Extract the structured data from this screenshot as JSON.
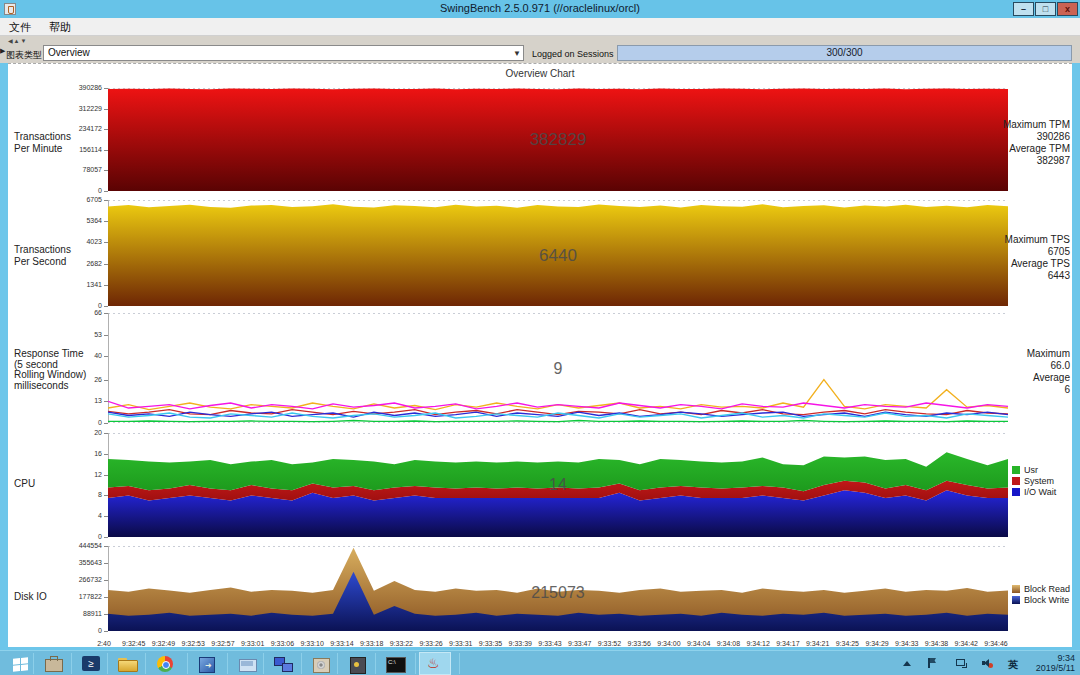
{
  "window": {
    "title": "SwingBench 2.5.0.971  (//oraclelinux/orcl)",
    "minimize": "–",
    "maximize": "□",
    "close": "x"
  },
  "menu": {
    "items": [
      "文件",
      "帮助"
    ]
  },
  "toolbar": {
    "chart_type_label": "图表类型",
    "chart_type_value": "Overview",
    "sessions_label": "Logged on Sessions",
    "sessions_value": "300/300"
  },
  "panel_title": "Overview Chart",
  "chart_data": {
    "type": "area",
    "x_labels": [
      "2:40",
      "9:32:45",
      "9:32:49",
      "9:32:53",
      "9:32:57",
      "9:33:01",
      "9:33:06",
      "9:33:10",
      "9:33:14",
      "9:33:18",
      "9:33:22",
      "9:33:26",
      "9:33:31",
      "9:33:35",
      "9:33:39",
      "9:33:43",
      "9:33:47",
      "9:33:52",
      "9:33:56",
      "9:34:00",
      "9:34:04",
      "9:34:08",
      "9:34:12",
      "9:34:17",
      "9:34:21",
      "9:34:25",
      "9:34:29",
      "9:34:33",
      "9:34:38",
      "9:34:42",
      "9:34:46"
    ],
    "charts": [
      {
        "id": "tpm",
        "type": "area",
        "title_lines": [
          "Transactions",
          "Per Minute"
        ],
        "ymax": 390286,
        "yticks": [
          390286,
          312229,
          234172,
          156114,
          78057,
          0
        ],
        "value_label": "382829",
        "stats_lines": [
          "Maximum TPM",
          "390286",
          "Average TPM",
          "382987"
        ],
        "series": [
          {
            "name": "TPM",
            "color_top": "#ee1313",
            "color_bottom": "#5a0303",
            "values": [
              386500,
              387800,
              386200,
              388400,
              387000,
              385600,
              388200,
              387400,
              386000,
              388600,
              387200,
              385800,
              387600,
              388800,
              386400,
              387000,
              388200,
              385600,
              387800,
              386600,
              388400,
              387000,
              385800,
              388000,
              386800,
              387600,
              385400,
              388200,
              387000,
              386200,
              388600,
              387400,
              385800,
              387200,
              388400,
              386000,
              387800,
              386600,
              388200,
              385600,
              387400,
              388000,
              386400,
              387800,
              386800
            ]
          }
        ]
      },
      {
        "id": "tps",
        "type": "area",
        "title_lines": [
          "Transactions",
          "Per Second"
        ],
        "ymax": 6705,
        "yticks": [
          6705,
          5364,
          4023,
          2682,
          1341,
          0
        ],
        "value_label": "6440",
        "stats_lines": [
          "Maximum TPS",
          "6705",
          "Average TPS",
          "6443"
        ],
        "series": [
          {
            "name": "TPS",
            "color_top": "#ecca10",
            "color_bottom": "#6e2604",
            "values": [
              6290,
              6380,
              6250,
              6330,
              6410,
              6270,
              6220,
              6350,
              6390,
              6260,
              6310,
              6430,
              6280,
              6230,
              6370,
              6320,
              6250,
              6400,
              6290,
              6340,
              6220,
              6380,
              6300,
              6260,
              6420,
              6330,
              6270,
              6350,
              6240,
              6390,
              6310,
              6280,
              6430,
              6250,
              6320,
              6370,
              6230,
              6360,
              6300,
              6410,
              6270,
              6340,
              6250,
              6380,
              6310
            ]
          }
        ]
      },
      {
        "id": "response",
        "type": "line",
        "title_lines": [
          "Response Time",
          "(5 second",
          "Rolling Window)",
          "milliseconds"
        ],
        "ymax": 66,
        "yticks": [
          66,
          53,
          40,
          26,
          13,
          0
        ],
        "value_label": "9",
        "stats_lines": [
          "Maximum",
          "66.0",
          "Average",
          "6"
        ],
        "series": [
          {
            "name": "red",
            "color": "#cc2a2a",
            "values": [
              7,
              5.5,
              6.5,
              8,
              5.5,
              5,
              7.5,
              6,
              5.5,
              8,
              6.5,
              5,
              7,
              5.5,
              6.5,
              8,
              5,
              6.5,
              7.5,
              5.5,
              8,
              6.5,
              5,
              7,
              6.5,
              5.5,
              8,
              5.5,
              6.5,
              5,
              7.5,
              6,
              8,
              5.5,
              5,
              6.5,
              7.5,
              5.5,
              8,
              6.5,
              5.5,
              5,
              7.5,
              6,
              5.5
            ]
          },
          {
            "name": "blue",
            "color": "#2a2ad4",
            "values": [
              6.5,
              4.5,
              5.5,
              4,
              6.5,
              5,
              4,
              5.5,
              6.5,
              4,
              5,
              6,
              3.5,
              6.5,
              4.5,
              6,
              4,
              5,
              6.5,
              4,
              6,
              5,
              4,
              6.5,
              4.5,
              6,
              4,
              5,
              6.5,
              5.5,
              4,
              5,
              6,
              6.5,
              4,
              5,
              6,
              4,
              6.5,
              5,
              4,
              6,
              5,
              6.5,
              5
            ]
          },
          {
            "name": "cyan",
            "color": "#3ac8ee",
            "values": [
              5.5,
              3.5,
              4.5,
              6,
              3.5,
              3,
              5.5,
              4.5,
              3.5,
              6,
              4,
              3,
              4.5,
              5.5,
              3.5,
              4.5,
              6,
              3,
              4,
              5.5,
              4.5,
              3.5,
              6,
              4.5,
              3,
              5.5,
              3.5,
              4.5,
              5.5,
              3,
              4.5,
              6,
              3.5,
              4.5,
              3,
              5.5,
              4.5,
              3.5,
              6,
              4,
              4.5,
              3,
              5.5,
              4.5,
              3.5
            ]
          },
          {
            "name": "green",
            "color": "#0cc83c",
            "values": [
              1,
              1,
              1.2,
              1,
              0.8,
              1,
              1,
              1.2,
              1,
              1,
              0.8,
              1,
              1.5,
              1,
              1,
              1.2,
              0.8,
              1,
              1,
              1,
              1.2,
              1,
              0.8,
              1.5,
              1,
              1,
              1.2,
              1,
              1,
              0.8,
              1,
              1.2,
              1,
              1,
              1.5,
              1,
              0.8,
              1,
              1.2,
              1,
              1,
              0.8,
              1.2,
              1,
              1
            ]
          },
          {
            "name": "orange",
            "color": "#f2b01e",
            "values": [
              9,
              11,
              8,
              10,
              12,
              9.5,
              8.5,
              11,
              10,
              9,
              12,
              10,
              8.5,
              11.5,
              9,
              10.5,
              8,
              11,
              9.5,
              12,
              10,
              8.5,
              11,
              9,
              10.5,
              12,
              9,
              10,
              8.5,
              11,
              9.5,
              10,
              9,
              12,
              9.5,
              26,
              10,
              8.5,
              11,
              10,
              9,
              20,
              9.5,
              10.5,
              9
            ]
          },
          {
            "name": "magenta",
            "color": "#f514e6",
            "values": [
              13,
              9,
              10,
              11,
              8.5,
              10.5,
              12,
              9,
              11,
              10,
              8.5,
              11.5,
              9.5,
              10.5,
              12,
              9,
              10,
              11.5,
              8.5,
              10,
              12,
              9.5,
              11,
              10,
              9,
              12,
              10.5,
              9,
              11,
              10,
              8.5,
              11.5,
              10,
              9.5,
              12,
              10.5,
              9,
              11,
              10,
              9.5,
              12,
              10.5,
              9,
              11,
              10
            ]
          }
        ]
      },
      {
        "id": "cpu",
        "type": "stacked",
        "title_lines": [
          "CPU"
        ],
        "ymax": 20,
        "yticks": [
          20,
          16,
          12,
          8,
          4,
          0
        ],
        "value_label": "14",
        "legend": [
          {
            "label": "Usr",
            "color": "#27b427"
          },
          {
            "label": "System",
            "color": "#c01818"
          },
          {
            "label": "I/O Wait",
            "color": "#1616c8"
          }
        ],
        "series": [
          {
            "name": "I/O Wait",
            "color_top": "#2626e0",
            "color_bottom": "#0a0a46",
            "values": [
              7.5,
              8,
              7,
              7.5,
              8,
              7.5,
              7,
              8,
              7.5,
              7,
              8.5,
              7.5,
              8,
              7,
              7.5,
              8,
              7.5,
              7.5,
              7.5,
              7.5,
              7.5,
              7.5,
              7.5,
              7.5,
              7.5,
              8.5,
              7,
              7.5,
              8,
              7.5,
              7.5,
              7.5,
              8,
              7.5,
              7,
              8,
              9,
              8.5,
              7.5,
              8,
              7,
              9,
              8,
              7.5,
              7.5
            ]
          },
          {
            "name": "System",
            "color_top": "#c01818",
            "color_bottom": "#a01010",
            "values": [
              2,
              1.8,
              2,
              1.8,
              2,
              1.8,
              2,
              2,
              1.8,
              2,
              1.8,
              2,
              1.8,
              2,
              2,
              1.8,
              2,
              1.8,
              2,
              1.8,
              2,
              1.8,
              2,
              1.8,
              2,
              1.8,
              2,
              2,
              1.8,
              2,
              1.8,
              2,
              1.8,
              2,
              1.8,
              2,
              1.8,
              2,
              1.8,
              2,
              2,
              1.8,
              2,
              1.8,
              2
            ]
          },
          {
            "name": "Usr",
            "color_top": "#2ab82a",
            "color_bottom": "#1d9a1d",
            "values": [
              5.5,
              5,
              5.5,
              5,
              4.5,
              5.5,
              5,
              4.5,
              5.5,
              5,
              4,
              5.5,
              5,
              5.5,
              4.5,
              5,
              5,
              5,
              5,
              5,
              5,
              5,
              5,
              5,
              5.5,
              4.5,
              5,
              5.5,
              5,
              5,
              5,
              5,
              5.5,
              4.5,
              5,
              5.5,
              4.5,
              5,
              5.5,
              5,
              4.5,
              5.5,
              5,
              4.5,
              5.5
            ]
          }
        ]
      },
      {
        "id": "diskio",
        "type": "area",
        "title_lines": [
          "Disk IO"
        ],
        "ymax": 444554,
        "yticks": [
          444554,
          355643,
          266732,
          177822,
          88911,
          0
        ],
        "value_label": "215073",
        "legend": [
          {
            "label": "Block Read",
            "color": "#c89a50",
            "color_top": "#e0ba70",
            "color_bottom": "#8a5422"
          },
          {
            "label": "Block Write",
            "color": "#2e4ad0",
            "color_top": "#4a66d8",
            "color_bottom": "#0b1254"
          }
        ],
        "series": [
          {
            "name": "Block Read",
            "color_top": "#d8ae5e",
            "color_bottom": "#8a5422",
            "values": [
              215000,
              205000,
              222000,
              212000,
              200000,
              215000,
              228000,
              205000,
              215000,
              210000,
              200000,
              215000,
              435000,
              210000,
              262000,
              215000,
              205000,
              222000,
              210000,
              215000,
              200000,
              222000,
              205000,
              215000,
              210000,
              200000,
              215000,
              222000,
              205000,
              210000,
              215000,
              200000,
              222000,
              212000,
              205000,
              215000,
              200000,
              210000,
              222000,
              205000,
              215000,
              210000,
              225000,
              205000,
              212000
            ]
          },
          {
            "name": "Block Write",
            "color_top": "#2e4ad0",
            "color_bottom": "#0b1254",
            "values": [
              90000,
              80000,
              85000,
              95000,
              80000,
              85000,
              90000,
              80000,
              95000,
              85000,
              80000,
              90000,
              310000,
              85000,
              130000,
              90000,
              80000,
              85000,
              95000,
              80000,
              90000,
              85000,
              80000,
              95000,
              85000,
              90000,
              80000,
              85000,
              90000,
              80000,
              95000,
              85000,
              80000,
              90000,
              85000,
              95000,
              80000,
              85000,
              90000,
              80000,
              85000,
              95000,
              80000,
              90000,
              85000
            ]
          }
        ]
      }
    ]
  },
  "taskbar": {
    "items": [
      {
        "icon": "windows-start"
      },
      {
        "icon": "server-manager"
      },
      {
        "icon": "powershell"
      },
      {
        "icon": "file-explorer"
      },
      {
        "icon": "chrome"
      },
      {
        "icon": "installer"
      },
      {
        "icon": "mail"
      },
      {
        "icon": "putty"
      },
      {
        "icon": "package"
      },
      {
        "icon": "safe"
      },
      {
        "icon": "cmd"
      },
      {
        "icon": "java",
        "active": true
      }
    ],
    "tray_ime": "英",
    "time": "9:34",
    "date": "2019/5/11"
  }
}
